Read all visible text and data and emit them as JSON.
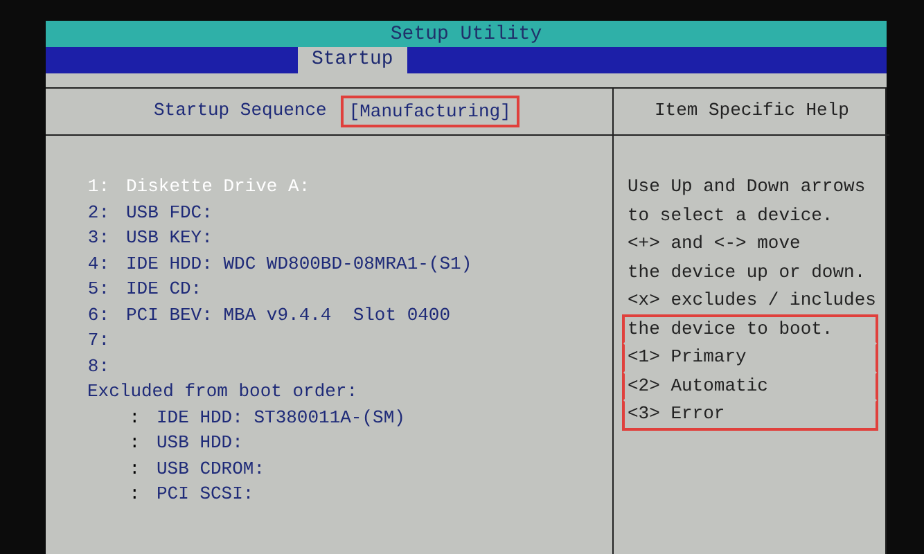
{
  "title": "Setup Utility",
  "tabs": [
    {
      "label": "Startup",
      "selected": true
    }
  ],
  "setting": {
    "label": "Startup Sequence",
    "value": "[Manufacturing]",
    "highlighted": true
  },
  "boot_order": [
    {
      "number": "1:",
      "label": "Diskette Drive A:",
      "selected": true
    },
    {
      "number": "2:",
      "label": "USB FDC:",
      "selected": false
    },
    {
      "number": "3:",
      "label": "USB KEY:",
      "selected": false
    },
    {
      "number": "4:",
      "label": "IDE HDD: WDC WD800BD-08MRA1-(S1)",
      "selected": false
    },
    {
      "number": "5:",
      "label": "IDE CD:",
      "selected": false
    },
    {
      "number": "6:",
      "label": "PCI BEV: MBA v9.4.4  Slot 0400",
      "selected": false
    },
    {
      "number": "7:",
      "selected": false
    },
    {
      "number": "8:",
      "selected": false
    }
  ],
  "excluded_title": "Excluded from boot order:",
  "excluded": [
    {
      "number": ":",
      "label": "IDE HDD: ST380011A-(SM)"
    },
    {
      "number": ":",
      "label": "USB HDD:"
    },
    {
      "number": ":",
      "label": "USB CDROM:"
    },
    {
      "number": ":",
      "label": "PCI SCSI:"
    }
  ],
  "help": {
    "title": "Item Specific Help",
    "lines": [
      {
        "text": "Use Up and Down arrows",
        "highlighted": false
      },
      {
        "text": "to select a device.",
        "highlighted": false
      },
      {
        "text": "<+> and <-> move",
        "highlighted": false
      },
      {
        "text": "the device up or down.",
        "highlighted": false
      },
      {
        "text": "<x> excludes / includes",
        "highlighted": false
      },
      {
        "text": "the device to boot.",
        "highlighted": true
      },
      {
        "text": "<1> Primary",
        "highlighted": true
      },
      {
        "text": "<2> Automatic",
        "highlighted": true
      },
      {
        "text": "<3> Error",
        "highlighted": true
      }
    ]
  }
}
